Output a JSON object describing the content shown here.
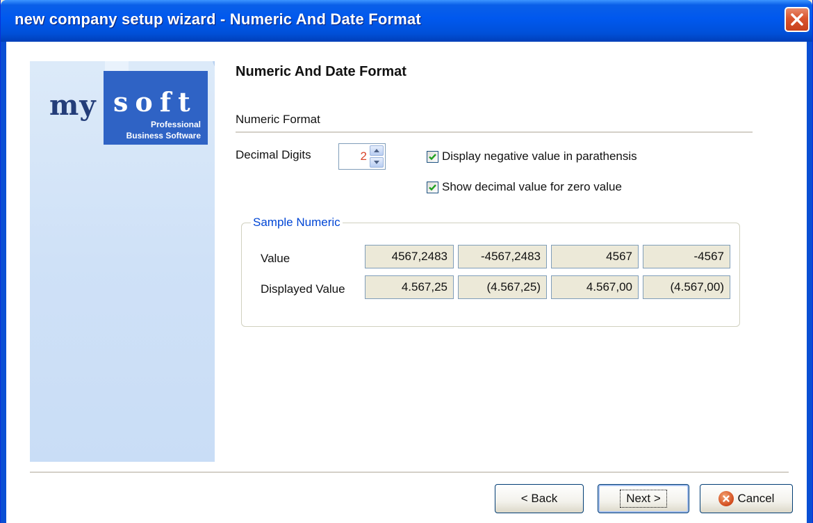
{
  "window": {
    "title": "new company setup wizard - Numeric And Date Format",
    "close_icon": "close-icon"
  },
  "brand": {
    "my": "my",
    "soft": "soft",
    "line1": "Professional",
    "line2": "Business Software",
    "watermark": "mySOFT"
  },
  "page": {
    "heading": "Numeric And Date Format",
    "group_label": "Numeric Format"
  },
  "decimal": {
    "label": "Decimal Digits",
    "value": "2"
  },
  "options": {
    "negative_parenthesis": {
      "label": "Display negative value in parathensis",
      "checked": true
    },
    "zero_decimal": {
      "label": "Show decimal value for zero value",
      "checked": true
    }
  },
  "sample": {
    "legend": "Sample Numeric",
    "value_label": "Value",
    "displayed_label": "Displayed Value",
    "values": [
      "4567,2483",
      "-4567,2483",
      "4567",
      "-4567"
    ],
    "displayed": [
      "4.567,25",
      "(4.567,25)",
      "4.567,00",
      "(4.567,00)"
    ]
  },
  "buttons": {
    "back": "< Back",
    "next": "Next >",
    "cancel": "Cancel"
  },
  "colors": {
    "title_bar": "#0058ee",
    "legend": "#0046d5",
    "spinner_value": "#d9442a"
  }
}
